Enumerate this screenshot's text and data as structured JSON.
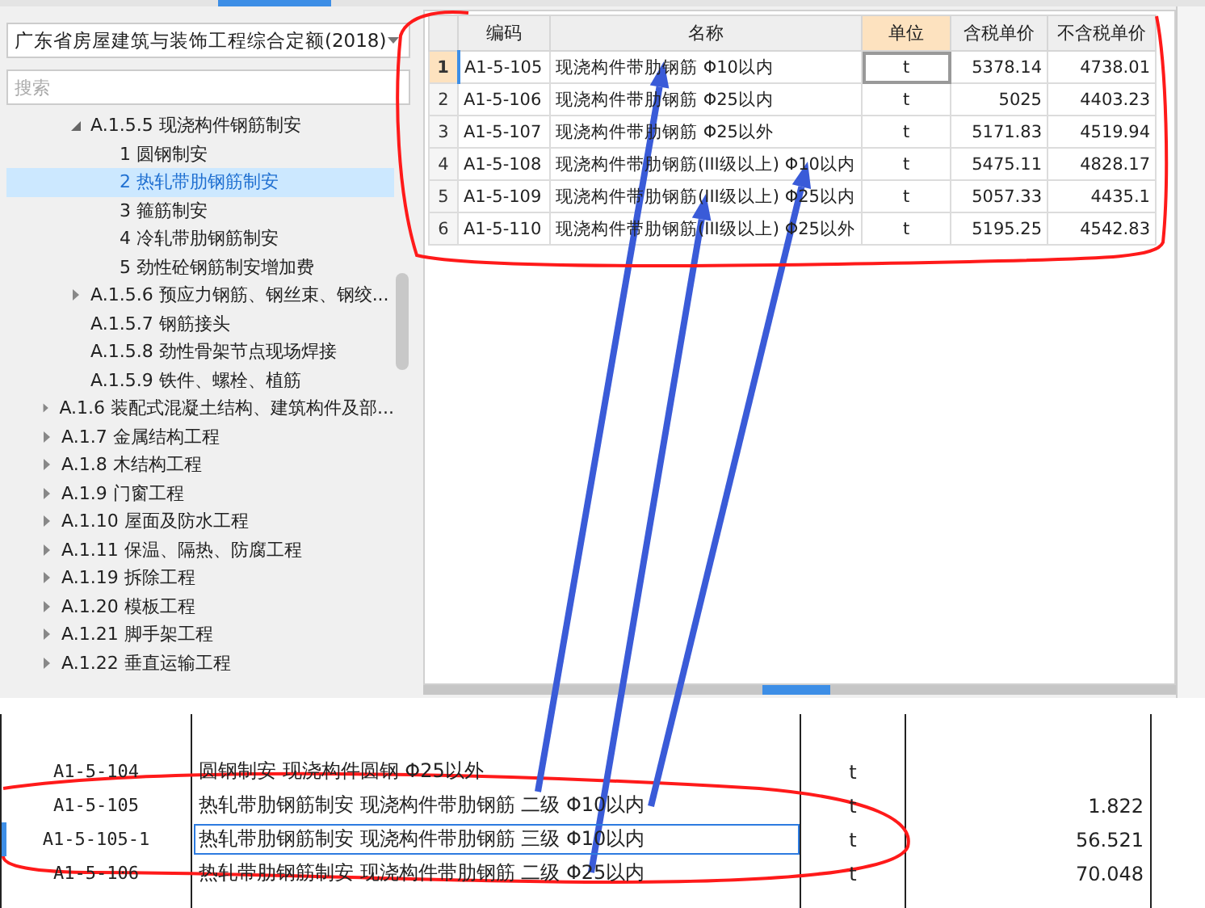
{
  "standard_dropdown": {
    "value": "广东省房屋建筑与装饰工程综合定额(2018)"
  },
  "search": {
    "placeholder": "搜索"
  },
  "tree": {
    "branch_children": [
      {
        "label": "A.1.5.5 现浇构件钢筋制安",
        "expandable": true,
        "expanded": true,
        "selected": false,
        "children": [
          {
            "label": "1 圆钢制安",
            "expandable": false,
            "selected": false
          },
          {
            "label": "2 热轧带肋钢筋制安",
            "expandable": false,
            "selected": true
          },
          {
            "label": "3 箍筋制安",
            "expandable": false,
            "selected": false
          },
          {
            "label": "4 冷轧带肋钢筋制安",
            "expandable": false,
            "selected": false
          },
          {
            "label": "5 劲性砼钢筋制安增加费",
            "expandable": false,
            "selected": false
          }
        ]
      },
      {
        "label": "A.1.5.6 预应力钢筋、钢丝束、钢绞...",
        "expandable": true,
        "expanded": false,
        "selected": false
      },
      {
        "label": "A.1.5.7 钢筋接头",
        "expandable": false,
        "selected": false
      },
      {
        "label": "A.1.5.8 劲性骨架节点现场焊接",
        "expandable": false,
        "selected": false
      },
      {
        "label": "A.1.5.9 铁件、螺栓、植筋",
        "expandable": false,
        "selected": false
      }
    ],
    "items": [
      {
        "label": "A.1.6 装配式混凝土结构、建筑构件及部...",
        "expandable": true,
        "expanded": false,
        "selected": false
      },
      {
        "label": "A.1.7 金属结构工程",
        "expandable": true,
        "expanded": false,
        "selected": false
      },
      {
        "label": "A.1.8 木结构工程",
        "expandable": true,
        "expanded": false,
        "selected": false
      },
      {
        "label": "A.1.9 门窗工程",
        "expandable": true,
        "expanded": false,
        "selected": false
      },
      {
        "label": "A.1.10 屋面及防水工程",
        "expandable": true,
        "expanded": false,
        "selected": false
      },
      {
        "label": "A.1.11 保温、隔热、防腐工程",
        "expandable": true,
        "expanded": false,
        "selected": false
      },
      {
        "label": "A.1.19 拆除工程",
        "expandable": true,
        "expanded": false,
        "selected": false
      },
      {
        "label": "A.1.20 模板工程",
        "expandable": true,
        "expanded": false,
        "selected": false
      },
      {
        "label": "A.1.21 脚手架工程",
        "expandable": true,
        "expanded": false,
        "selected": false
      },
      {
        "label": "A.1.22 垂直运输工程",
        "expandable": true,
        "expanded": false,
        "selected": false
      }
    ]
  },
  "quota_table": {
    "columns": [
      {
        "label": "编码",
        "selected": false
      },
      {
        "label": "名称",
        "selected": false
      },
      {
        "label": "单位",
        "selected": true
      },
      {
        "label": "含税单价",
        "selected": false
      },
      {
        "label": "不含税单价",
        "selected": false
      }
    ],
    "rows": [
      {
        "index": "1",
        "code": "A1-5-105",
        "name": "现浇构件带肋钢筋 Φ10以内",
        "unit": "t",
        "tax_price": "5378.14",
        "net_price": "4738.01",
        "selected": true
      },
      {
        "index": "2",
        "code": "A1-5-106",
        "name": "现浇构件带肋钢筋 Φ25以内",
        "unit": "t",
        "tax_price": "5025",
        "net_price": "4403.23",
        "selected": false
      },
      {
        "index": "3",
        "code": "A1-5-107",
        "name": "现浇构件带肋钢筋 Φ25以外",
        "unit": "t",
        "tax_price": "5171.83",
        "net_price": "4519.94",
        "selected": false
      },
      {
        "index": "4",
        "code": "A1-5-108",
        "name": "现浇构件带肋钢筋(III级以上) Φ10以内",
        "unit": "t",
        "tax_price": "5475.11",
        "net_price": "4828.17",
        "selected": false
      },
      {
        "index": "5",
        "code": "A1-5-109",
        "name": "现浇构件带肋钢筋(III级以上) Φ25以内",
        "unit": "t",
        "tax_price": "5057.33",
        "net_price": "4435.1",
        "selected": false
      },
      {
        "index": "6",
        "code": "A1-5-110",
        "name": "现浇构件带肋钢筋(III级以上) Φ25以外",
        "unit": "t",
        "tax_price": "5195.25",
        "net_price": "4542.83",
        "selected": false
      }
    ]
  },
  "bill_table": {
    "rows": [
      {
        "code": "A1-5-104",
        "name": "圆钢制安 现浇构件圆钢 Φ25以外",
        "unit": "t",
        "quantity": "",
        "selected": false
      },
      {
        "code": "A1-5-105",
        "name": "热轧带肋钢筋制安 现浇构件带肋钢筋 二级 Φ10以内",
        "unit": "t",
        "quantity": "1.822",
        "selected": false
      },
      {
        "code": "A1-5-105-1",
        "name": "热轧带肋钢筋制安 现浇构件带肋钢筋 三级 Φ10以内",
        "unit": "t",
        "quantity": "56.521",
        "selected": true
      },
      {
        "code": "A1-5-106",
        "name": "热轧带肋钢筋制安 现浇构件带肋钢筋 二级 Φ25以内",
        "unit": "t",
        "quantity": "70.048",
        "selected": false
      }
    ]
  }
}
